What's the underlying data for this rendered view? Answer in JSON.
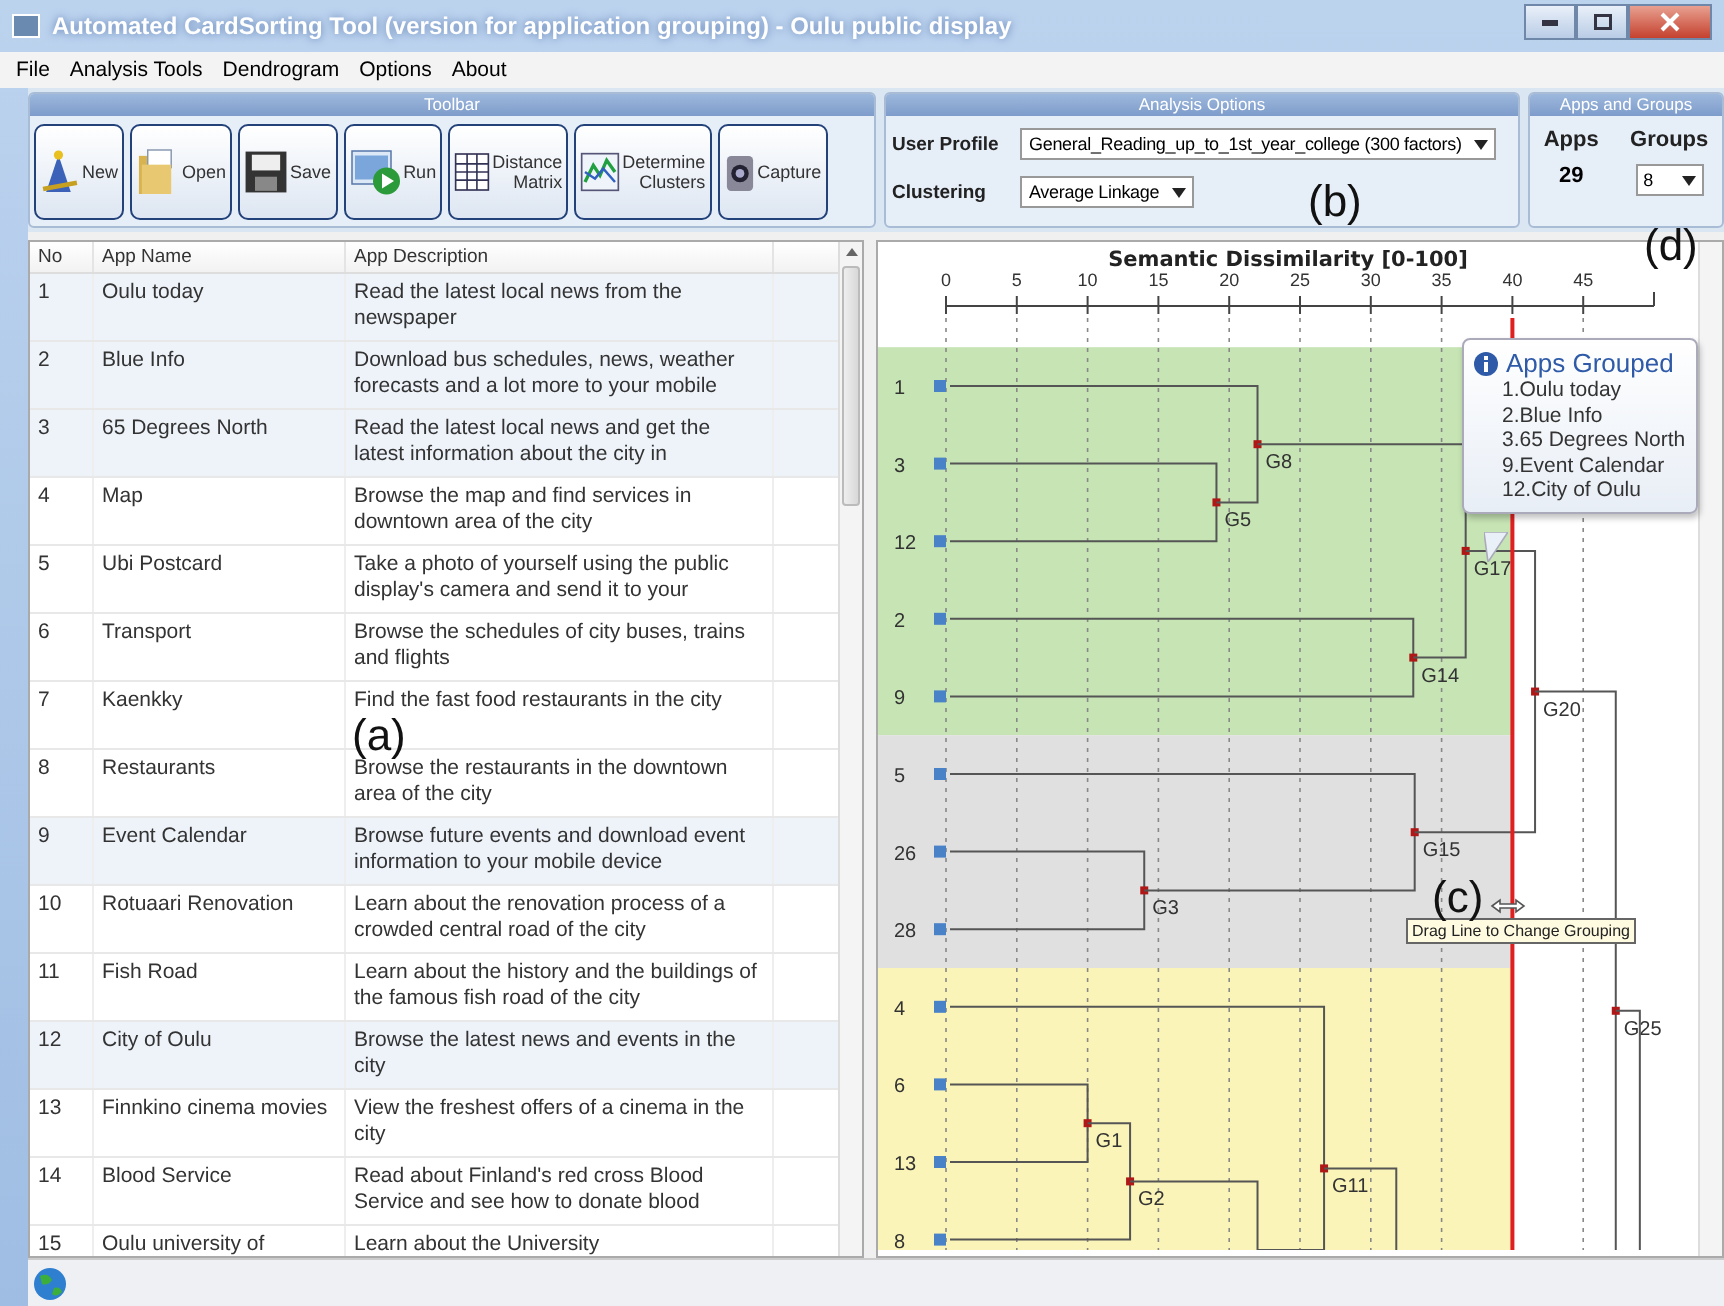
{
  "window": {
    "title": "Automated CardSorting Tool (version for application grouping) - Oulu public display"
  },
  "menu": [
    "File",
    "Analysis Tools",
    "Dendrogram",
    "Options",
    "About"
  ],
  "toolbar": {
    "title": "Toolbar",
    "buttons": [
      {
        "kind": "new",
        "label": "New"
      },
      {
        "kind": "open",
        "label": "Open"
      },
      {
        "kind": "save",
        "label": "Save"
      },
      {
        "kind": "run",
        "label": "Run"
      },
      {
        "kind": "matrix",
        "label": "Distance Matrix"
      },
      {
        "kind": "clusters",
        "label": "Determine Clusters"
      },
      {
        "kind": "capture",
        "label": "Capture"
      }
    ]
  },
  "analysis_options": {
    "title": "Analysis Options",
    "user_profile": {
      "label": "User Profile",
      "value": "General_Reading_up_to_1st_year_college (300 factors)"
    },
    "clustering": {
      "label": "Clustering",
      "value": "Average Linkage"
    }
  },
  "apps_and_groups": {
    "title": "Apps and Groups",
    "apps_label": "Apps",
    "apps_value": "29",
    "groups_label": "Groups",
    "groups_value": "8"
  },
  "table": {
    "columns": [
      "No",
      "App Name",
      "App Description"
    ],
    "rows": [
      {
        "no": "1",
        "name": "Oulu today",
        "description": "Read the latest local news from the newspaper",
        "selected": true
      },
      {
        "no": "2",
        "name": "Blue Info",
        "description": "Download bus schedules, news, weather forecasts and a lot more to your mobile",
        "selected": true
      },
      {
        "no": "3",
        "name": "65 Degrees North",
        "description": "Read the latest local news and get the latest information about the city in",
        "selected": true
      },
      {
        "no": "4",
        "name": "Map",
        "description": "Browse the map and find services in downtown area of the city",
        "selected": false
      },
      {
        "no": "5",
        "name": "Ubi Postcard",
        "description": "Take a photo of yourself using the public display's camera and send it to your",
        "selected": false
      },
      {
        "no": "6",
        "name": "Transport",
        "description": "Browse the schedules of city buses, trains and flights",
        "selected": false
      },
      {
        "no": "7",
        "name": "Kaenkky",
        "description": "Find the fast food restaurants in the city",
        "selected": false
      },
      {
        "no": "8",
        "name": "Restaurants",
        "description": "Browse the restaurants in the downtown area of the city",
        "selected": false
      },
      {
        "no": "9",
        "name": "Event Calendar",
        "description": "Browse future events and download event information to your mobile device",
        "selected": true
      },
      {
        "no": "10",
        "name": "Rotuaari Renovation",
        "description": "Learn about the renovation process of a crowded central road of the city",
        "selected": false
      },
      {
        "no": "11",
        "name": "Fish Road",
        "description": "Learn about the history and the buildings of the famous fish road of the city",
        "selected": false
      },
      {
        "no": "12",
        "name": "City of Oulu",
        "description": "Browse the latest news and events in the city",
        "selected": true
      },
      {
        "no": "13",
        "name": "Finnkino cinema movies",
        "description": "View the freshest offers of a cinema in the city",
        "selected": false
      },
      {
        "no": "14",
        "name": "Blood Service",
        "description": "Read about Finland's red cross Blood Service and see how to donate blood",
        "selected": false
      },
      {
        "no": "15",
        "name": "Oulu university of",
        "description": "Learn about the University",
        "selected": false
      }
    ]
  },
  "dendrogram": {
    "title": "Semantic Dissimilarity [0-100]",
    "ticks": [
      "0",
      "5",
      "10",
      "15",
      "20",
      "25",
      "30",
      "35",
      "40",
      "45"
    ],
    "cut_line": {
      "kind": "drag_line"
    },
    "tree": {
      "kind": "hidden",
      "children": [
        {
          "kind": "group",
          "label": "G25",
          "children": [
            {
              "kind": "group",
              "label": "G20",
              "children": [
                {
                  "kind": "group",
                  "label": "G17",
                  "children": [
                    {
                      "kind": "group",
                      "label": "G8",
                      "children": [
                        {
                          "kind": "leaf",
                          "label": "1",
                          "color": "#c6e4b4"
                        },
                        {
                          "kind": "group",
                          "label": "G5",
                          "children": [
                            {
                              "kind": "leaf",
                              "label": "3",
                              "color": "#c6e4b4"
                            },
                            {
                              "kind": "leaf",
                              "label": "12",
                              "color": "#c6e4b4"
                            }
                          ]
                        }
                      ]
                    },
                    {
                      "kind": "group",
                      "label": "G14",
                      "children": [
                        {
                          "kind": "leaf",
                          "label": "2",
                          "color": "#c6e4b4"
                        },
                        {
                          "kind": "leaf",
                          "label": "9",
                          "color": "#c6e4b4"
                        }
                      ]
                    }
                  ]
                },
                {
                  "kind": "group",
                  "label": "G15",
                  "children": [
                    {
                      "kind": "leaf",
                      "label": "5",
                      "color": "#e0e0e0"
                    },
                    {
                      "kind": "group",
                      "label": "G3",
                      "children": [
                        {
                          "kind": "leaf",
                          "label": "26",
                          "color": "#e0e0e0"
                        },
                        {
                          "kind": "leaf",
                          "label": "28",
                          "color": "#e0e0e0"
                        }
                      ]
                    }
                  ]
                }
              ]
            },
            {
              "kind": "hidden",
              "children": [
                {
                  "kind": "hidden",
                  "children": [
                    {
                      "kind": "group",
                      "label": "G11",
                      "children": [
                        {
                          "kind": "leaf",
                          "label": "4",
                          "color": "#fbf4b8"
                        },
                        {
                          "kind": "hidden",
                          "children": [
                            {
                              "kind": "group",
                              "label": "G2",
                              "children": [
                                {
                                  "kind": "group",
                                  "label": "G1",
                                  "children": [
                                    {
                                      "kind": "leaf",
                                      "label": "6",
                                      "color": "#fbf4b8"
                                    },
                                    {
                                      "kind": "leaf",
                                      "label": "13",
                                      "color": "#fbf4b8"
                                    }
                                  ]
                                },
                                {
                                  "kind": "leaf",
                                  "label": "8",
                                  "color": "#fbf4b8"
                                }
                              ]
                            },
                            {
                              "kind": "hidden"
                            }
                          ]
                        }
                      ]
                    },
                    {
                      "kind": "hidden"
                    }
                  ]
                }
              ]
            }
          ]
        },
        {
          "kind": "hidden"
        }
      ]
    },
    "balloon": {
      "title": "Apps Grouped",
      "items": [
        "1.Oulu today",
        "2.Blue Info",
        "3.65 Degrees North",
        "9.Event Calendar",
        "12.City of Oulu"
      ]
    },
    "hint": "Drag Line to Change Grouping"
  },
  "annotations": [
    {
      "kind": "a",
      "text": "(a)"
    },
    {
      "kind": "b",
      "text": "(b)"
    },
    {
      "kind": "c",
      "text": "(c)"
    },
    {
      "kind": "d",
      "text": "(d)"
    }
  ]
}
